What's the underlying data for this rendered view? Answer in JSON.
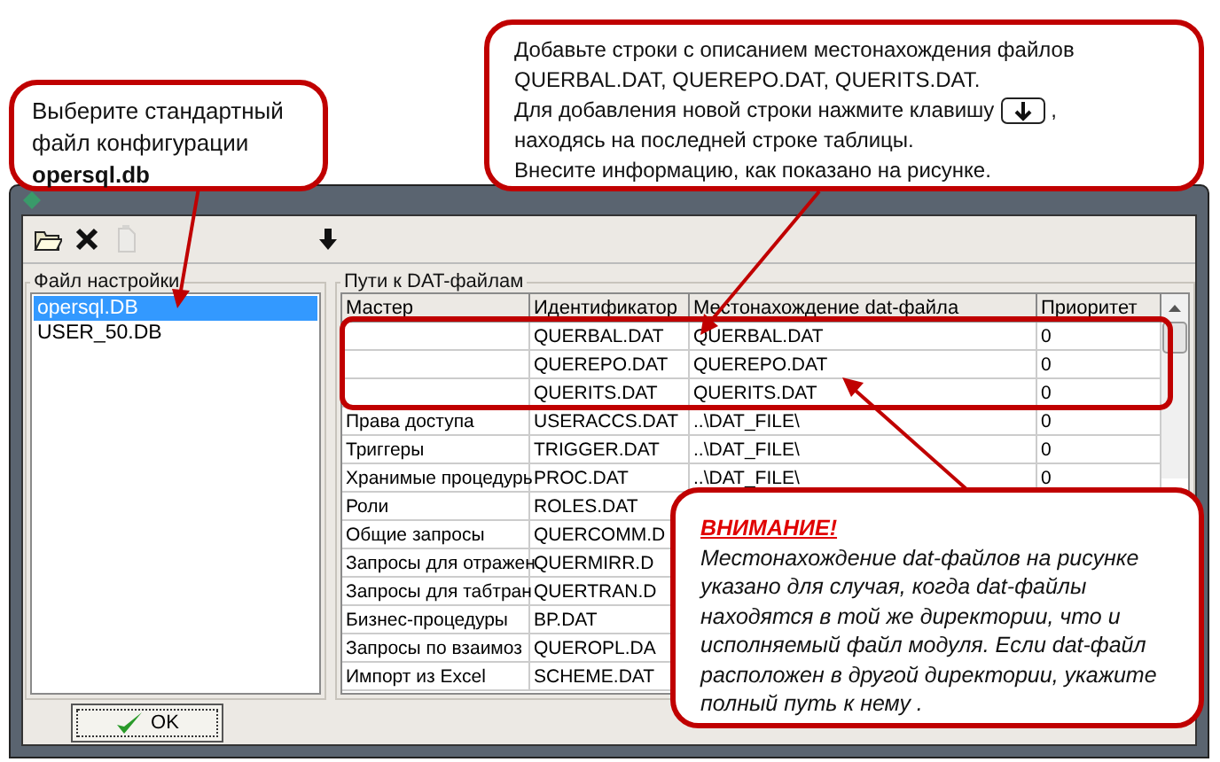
{
  "dialog": {
    "toolbar": [
      {
        "kind": "open",
        "disabled": false
      },
      {
        "kind": "delete",
        "disabled": false
      },
      {
        "kind": "document",
        "disabled": true
      },
      {
        "kind": "down",
        "disabled": false
      }
    ],
    "settings_group": {
      "title": "Файл настройки",
      "items": [
        {
          "label": "opersql.DB",
          "selected": true
        },
        {
          "label": "USER_50.DB",
          "selected": false
        }
      ]
    },
    "paths_group": {
      "title": "Пути к DAT-файлам",
      "columns": [
        "Мастер",
        "Идентификатор",
        "Местонахождение dat-файла",
        "Приоритет"
      ],
      "rows": [
        {
          "identifier": "QUERBAL.DAT",
          "location": "QUERBAL.DAT",
          "priority": "0"
        },
        {
          "identifier": "QUEREPO.DAT",
          "location": "QUEREPO.DAT",
          "priority": "0"
        },
        {
          "identifier": "QUERITS.DAT",
          "location": "QUERITS.DAT",
          "priority": "0"
        },
        {
          "master": "Права доступа",
          "identifier": "USERACCS.DAT",
          "location": "..\\DAT_FILE\\",
          "priority": "0"
        },
        {
          "master": "Триггеры",
          "identifier": "TRIGGER.DAT",
          "location": "..\\DAT_FILE\\",
          "priority": "0"
        },
        {
          "master": "Хранимые процедурь",
          "identifier": "PROC.DAT",
          "location": "..\\DAT_FILE\\",
          "priority": "0"
        },
        {
          "master": "Роли",
          "identifier": "ROLES.DAT"
        },
        {
          "master": "Общие запросы",
          "identifier": "QUERCOMM.D"
        },
        {
          "master": "Запросы для отражен",
          "identifier": "QUERMIRR.D"
        },
        {
          "master": "Запросы для табтран",
          "identifier": "QUERTRAN.D"
        },
        {
          "master": "Бизнес-процедуры",
          "identifier": "BP.DAT"
        },
        {
          "master": "Запросы по взаимоз",
          "identifier": "QUEROPL.DA"
        },
        {
          "master": "Импорт из Excel",
          "identifier": "SCHEME.DAT"
        }
      ]
    },
    "ok_button": "OK"
  },
  "callout_config": {
    "text": "Выберите стандартный файл конфигурации **opersql.db**"
  },
  "callout_rows": {
    "lines": [
      {
        "text": "Добавьте строки с описанием местонахождения файлов"
      },
      {
        "text": "QUERBAL.DAT,  QUEREPO.DAT,  QUERITS.DAT."
      },
      {
        "text": "Для добавления новой строки нажмите клавишу",
        "key": true,
        "after": ","
      },
      {
        "text": "находясь на последней строке таблицы."
      },
      {
        "text": "Внесите информацию, как показано на рисунке."
      }
    ]
  },
  "callout_warning": {
    "title": "ВНИМАНИЕ!",
    "text": "Местонахождение dat-файлов на рисунке указано для случая, когда dat-файлы находятся в той же  директории,  что и исполняемый файл модуля.  Если dat-файл расположен в другой директории, укажите полный путь к нему ."
  }
}
